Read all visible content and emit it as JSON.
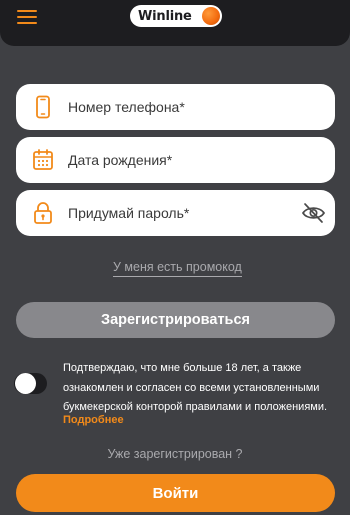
{
  "header": {
    "logo_text": "Winline",
    "menu_icon": "hamburger-menu-icon"
  },
  "form": {
    "phone_label": "Номер телефона*",
    "birthdate_label": "Дата рождения*",
    "password_label": "Придумай пароль*",
    "phone_icon": "phone-icon",
    "birthdate_icon": "calendar-icon",
    "password_icon": "lock-icon",
    "password_visibility_icon": "eye-off-icon",
    "promo_link": "У меня есть промокод",
    "register_button": "Зарегистрироваться"
  },
  "consent": {
    "toggle_state": "off",
    "text": "Подтверждаю, что мне больше 18 лет, а также ознакомлен и согласен со всеми установленными букмекерской конторой правилами и положениями.",
    "more_link": "Подробнее"
  },
  "footer": {
    "already_registered": "Уже зарегистрирован ?",
    "login_button": "Войти"
  },
  "colors": {
    "background": "#3f4044",
    "header": "#1d1d20",
    "accent": "#f28a1a",
    "disabled_button": "#88888c",
    "input_background": "#ffffff"
  }
}
